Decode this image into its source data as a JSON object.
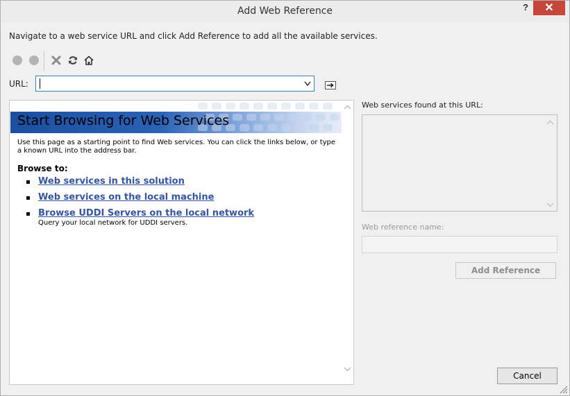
{
  "window": {
    "title": "Add Web Reference",
    "help_label": "?",
    "close_label": "✕"
  },
  "instruction": "Navigate to a web service URL and click Add Reference to add all the available services.",
  "url": {
    "label": "URL:",
    "value": ""
  },
  "browser": {
    "banner_title": "Start Browsing for Web Services",
    "intro": "Use this page as a starting point to find Web services. You can click the links below, or type a known URL into the address bar.",
    "browse_to": "Browse to:",
    "links": [
      {
        "label": "Web services in this solution",
        "sub": ""
      },
      {
        "label": "Web services on the local machine",
        "sub": ""
      },
      {
        "label": "Browse UDDI Servers on the local network",
        "sub": "Query your local network for UDDI servers."
      }
    ]
  },
  "right_panel": {
    "found_label": "Web services found at this URL:",
    "ref_name_label": "Web reference name:",
    "ref_name_value": "",
    "add_reference_label": "Add Reference"
  },
  "footer": {
    "cancel_label": "Cancel"
  },
  "colors": {
    "link": "#3455a4",
    "banner": "#1b4ea0",
    "close_button": "#c7463c",
    "url_border": "#3c7fb1"
  }
}
